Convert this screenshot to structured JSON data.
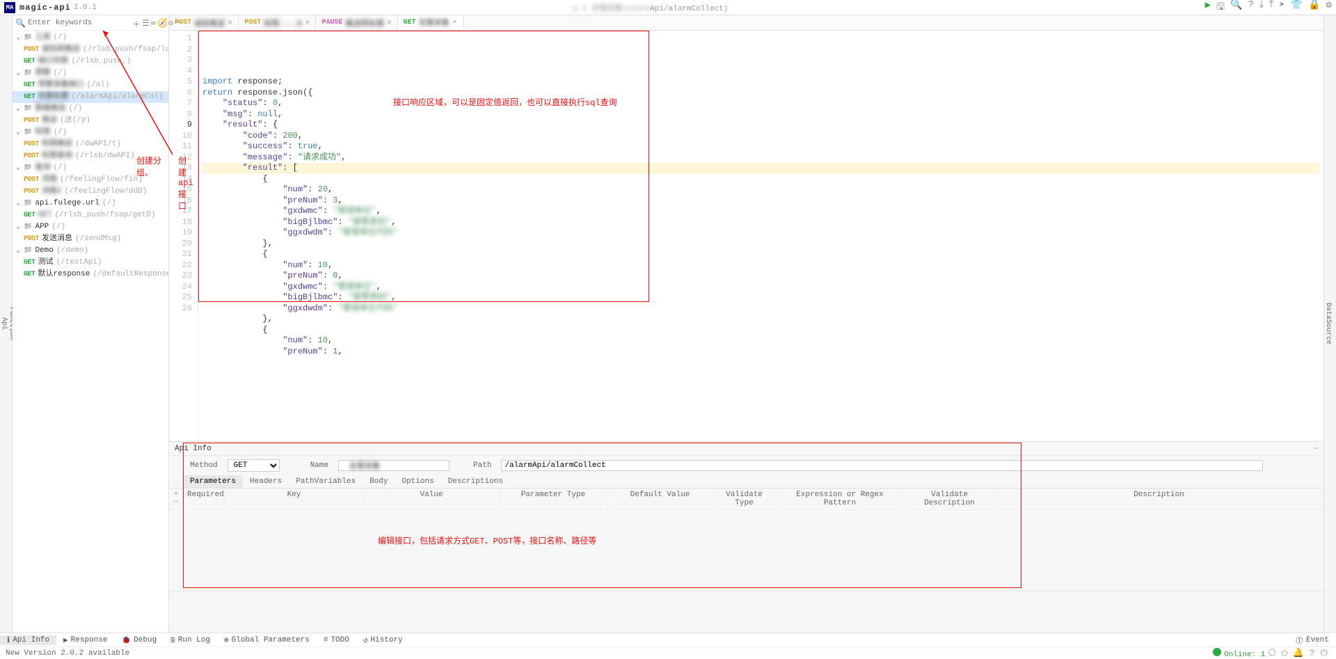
{
  "app": {
    "name": "magic-api",
    "version": "2.0.1",
    "logo": "MA"
  },
  "breadcrumb_suffix": "Api/alarmCollect)",
  "toolbar_icons": [
    "play",
    "save",
    "search",
    "help",
    "cloud-down",
    "cloud-up",
    "send",
    "tshirt",
    "lock",
    "settings"
  ],
  "left_rail": [
    "Api",
    "Function"
  ],
  "right_rail": [
    "DataSource"
  ],
  "tree": {
    "search_placeholder": "Enter keywords",
    "items": [
      {
        "d": 0,
        "type": "folder",
        "name_blur": true,
        "name": "工商",
        "path": "/"
      },
      {
        "d": 1,
        "type": "api",
        "method": "POST",
        "name_blur": true,
        "name": "诚信网推送",
        "path": "/rlsb_push/fsap/login"
      },
      {
        "d": 1,
        "type": "api",
        "method": "GET",
        "name_blur": true,
        "name": "接口列表",
        "path": "/rlsb_push,"
      },
      {
        "d": 0,
        "type": "folder",
        "name_blur": true,
        "name": "预警",
        "path": "/"
      },
      {
        "d": 1,
        "type": "api",
        "method": "GET",
        "name_blur": true,
        "name": "预警采集接口",
        "path": "/al"
      },
      {
        "d": 1,
        "type": "api",
        "method": "GET",
        "name_blur": true,
        "name": "告警处置",
        "path": "/alarmApi/alarmCol",
        "selected": true
      },
      {
        "d": 0,
        "type": "folder",
        "name_blur": true,
        "name": "数据推送",
        "path": "/"
      },
      {
        "d": 1,
        "type": "api",
        "method": "POST",
        "name_blur": true,
        "name": "推送",
        "path": "送(/p"
      },
      {
        "d": 0,
        "type": "folder",
        "name_blur": true,
        "name": "权限",
        "path": "/"
      },
      {
        "d": 1,
        "type": "api",
        "method": "POST",
        "name_blur": true,
        "name": "权限推送",
        "path": "/dwAPI/t"
      },
      {
        "d": 1,
        "type": "api",
        "method": "POST",
        "name_blur": true,
        "name": "权限查询",
        "path": "/rlsb/dwAPI"
      },
      {
        "d": 0,
        "type": "folder",
        "name_blur": true,
        "name": "查询",
        "path": "/"
      },
      {
        "d": 1,
        "type": "api",
        "method": "POST",
        "name_blur": true,
        "name": "流程",
        "path": "/feelingFlow/fin"
      },
      {
        "d": 1,
        "type": "api",
        "method": "POST",
        "name_blur": true,
        "name": "流程2",
        "path": "/feelingFlow/ddD"
      },
      {
        "d": 0,
        "type": "folder",
        "name": "api.fulege.url",
        "path": "/"
      },
      {
        "d": 1,
        "type": "api",
        "method": "GET",
        "name_blur": true,
        "name": "GET",
        "path": "/rlsb_push/fsap/getD"
      },
      {
        "d": 0,
        "type": "folder",
        "name": "APP",
        "path": "/"
      },
      {
        "d": 1,
        "type": "api",
        "method": "POST",
        "name": "发送消息",
        "path": "/sendMsg"
      },
      {
        "d": 0,
        "type": "folder",
        "name": "Demo",
        "path": "/demo"
      },
      {
        "d": 1,
        "type": "api",
        "method": "GET",
        "name": "测试",
        "path": "/testApi"
      },
      {
        "d": 1,
        "type": "api",
        "method": "GET",
        "name": "默认response",
        "path": "/defaultResponse"
      }
    ]
  },
  "tabs": [
    {
      "method": "POST",
      "label_blur": true,
      "label": "诚信推送",
      "close": true
    },
    {
      "method": "POST",
      "label_blur": true,
      "label": "权限....K",
      "close": true
    },
    {
      "method": "PAUSE",
      "label_blur": true,
      "label": "推送预处理",
      "close": true
    },
    {
      "method": "GET",
      "label_blur": true,
      "label": "告警采集",
      "active": true,
      "close": true
    }
  ],
  "gutter_lines": 26,
  "code_tokens": [
    [
      {
        "t": "import",
        "c": "kw"
      },
      {
        "t": " response;",
        "c": "id"
      }
    ],
    [
      {
        "t": "return",
        "c": "kw"
      },
      {
        "t": " response.json({",
        "c": "id"
      }
    ],
    [
      {
        "t": "    ",
        "c": ""
      },
      {
        "t": "\"status\"",
        "c": "prop"
      },
      {
        "t": ": ",
        "c": "id"
      },
      {
        "t": "0",
        "c": "num"
      },
      {
        "t": ",",
        "c": "id"
      }
    ],
    [
      {
        "t": "    ",
        "c": ""
      },
      {
        "t": "\"msg\"",
        "c": "prop"
      },
      {
        "t": ": ",
        "c": "id"
      },
      {
        "t": "null",
        "c": "kw"
      },
      {
        "t": ",",
        "c": "id"
      }
    ],
    [
      {
        "t": "    ",
        "c": ""
      },
      {
        "t": "\"result\"",
        "c": "prop"
      },
      {
        "t": ": {",
        "c": "id"
      }
    ],
    [
      {
        "t": "        ",
        "c": ""
      },
      {
        "t": "\"code\"",
        "c": "prop"
      },
      {
        "t": ": ",
        "c": "id"
      },
      {
        "t": "200",
        "c": "num"
      },
      {
        "t": ",",
        "c": "id"
      }
    ],
    [
      {
        "t": "        ",
        "c": ""
      },
      {
        "t": "\"success\"",
        "c": "prop"
      },
      {
        "t": ": ",
        "c": "id"
      },
      {
        "t": "true",
        "c": "kw"
      },
      {
        "t": ",",
        "c": "id"
      }
    ],
    [
      {
        "t": "        ",
        "c": ""
      },
      {
        "t": "\"message\"",
        "c": "prop"
      },
      {
        "t": ": ",
        "c": "id"
      },
      {
        "t": "\"请求成功\"",
        "c": "str"
      },
      {
        "t": ",",
        "c": "id"
      }
    ],
    [
      {
        "t": "        ",
        "c": ""
      },
      {
        "t": "\"result\"",
        "c": "prop"
      },
      {
        "t": ": [",
        "c": "id"
      }
    ],
    [
      {
        "t": "            {",
        "c": "id"
      }
    ],
    [
      {
        "t": "                ",
        "c": ""
      },
      {
        "t": "\"num\"",
        "c": "prop"
      },
      {
        "t": ": ",
        "c": "id"
      },
      {
        "t": "20",
        "c": "num"
      },
      {
        "t": ",",
        "c": "id"
      }
    ],
    [
      {
        "t": "                ",
        "c": ""
      },
      {
        "t": "\"preNum\"",
        "c": "prop"
      },
      {
        "t": ": ",
        "c": "id"
      },
      {
        "t": "3",
        "c": "num"
      },
      {
        "t": ",",
        "c": "id"
      }
    ],
    [
      {
        "t": "                ",
        "c": ""
      },
      {
        "t": "\"gxdwmc\"",
        "c": "prop"
      },
      {
        "t": ": ",
        "c": "id"
      },
      {
        "t": "\"管辖单位\"",
        "c": "str",
        "blur": true
      },
      {
        "t": ",",
        "c": "id"
      }
    ],
    [
      {
        "t": "                ",
        "c": ""
      },
      {
        "t": "\"bigBjlbmc\"",
        "c": "prop"
      },
      {
        "t": ": ",
        "c": "id"
      },
      {
        "t": "\"报警类别\"",
        "c": "str",
        "blur": true
      },
      {
        "t": ",",
        "c": "id"
      }
    ],
    [
      {
        "t": "                ",
        "c": ""
      },
      {
        "t": "\"ggxdwdm\"",
        "c": "prop"
      },
      {
        "t": ": ",
        "c": "id"
      },
      {
        "t": "\"管辖单位代码\"",
        "c": "str",
        "blur": true
      }
    ],
    [
      {
        "t": "            },",
        "c": "id"
      }
    ],
    [
      {
        "t": "            {",
        "c": "id"
      }
    ],
    [
      {
        "t": "                ",
        "c": ""
      },
      {
        "t": "\"num\"",
        "c": "prop"
      },
      {
        "t": ": ",
        "c": "id"
      },
      {
        "t": "10",
        "c": "num"
      },
      {
        "t": ",",
        "c": "id"
      }
    ],
    [
      {
        "t": "                ",
        "c": ""
      },
      {
        "t": "\"preNum\"",
        "c": "prop"
      },
      {
        "t": ": ",
        "c": "id"
      },
      {
        "t": "0",
        "c": "num"
      },
      {
        "t": ",",
        "c": "id"
      }
    ],
    [
      {
        "t": "                ",
        "c": ""
      },
      {
        "t": "\"gxdwmc\"",
        "c": "prop"
      },
      {
        "t": ": ",
        "c": "id"
      },
      {
        "t": "\"管辖单位\"",
        "c": "str",
        "blur": true
      },
      {
        "t": ",",
        "c": "id"
      }
    ],
    [
      {
        "t": "                ",
        "c": ""
      },
      {
        "t": "\"bigBjlbmc\"",
        "c": "prop"
      },
      {
        "t": ": ",
        "c": "id"
      },
      {
        "t": "\"报警类别\"",
        "c": "str",
        "blur": true
      },
      {
        "t": ",",
        "c": "id"
      }
    ],
    [
      {
        "t": "                ",
        "c": ""
      },
      {
        "t": "\"ggxdwdm\"",
        "c": "prop"
      },
      {
        "t": ": ",
        "c": "id"
      },
      {
        "t": "\"管辖单位代码\"",
        "c": "str",
        "blur": true
      }
    ],
    [
      {
        "t": "            },",
        "c": "id"
      }
    ],
    [
      {
        "t": "            {",
        "c": "id"
      }
    ],
    [
      {
        "t": "                ",
        "c": ""
      },
      {
        "t": "\"num\"",
        "c": "prop"
      },
      {
        "t": ": ",
        "c": "id"
      },
      {
        "t": "10",
        "c": "num"
      },
      {
        "t": ",",
        "c": "id"
      }
    ],
    [
      {
        "t": "                ",
        "c": ""
      },
      {
        "t": "\"preNum\"",
        "c": "prop"
      },
      {
        "t": ": ",
        "c": "id"
      },
      {
        "t": "1",
        "c": "num"
      },
      {
        "t": ",",
        "c": "id"
      }
    ]
  ],
  "code_highlight_line": 9,
  "code_annotation": "接口响应区域，可以是固定值返回，也可以直接执行sql查询",
  "tree_annotation_group": "创建分组、",
  "tree_annotation_api": "创建api接口",
  "apiinfo": {
    "title": "Api Info",
    "method_label": "Method",
    "method_value": "GET",
    "name_label": "Name",
    "name_value": "告警采集",
    "path_label": "Path",
    "path_value": "/alarmApi/alarmCollect",
    "tabs": [
      "Parameters",
      "Headers",
      "PathVariables",
      "Body",
      "Options",
      "Descriptions"
    ],
    "active_tab": 0,
    "grid_headers": [
      "Required",
      "Key",
      "Value",
      "Parameter Type",
      "Default Value",
      "Validate Type",
      "Expression or Regex Pattern",
      "Validate Description",
      "Description"
    ],
    "annotation": "编辑接口，包括请求方式GET、POST等，接口名称、路径等"
  },
  "footer_tabs": [
    {
      "icon": "ℹ",
      "label": "Api Info",
      "active": true
    },
    {
      "icon": "▶",
      "label": "Response"
    },
    {
      "icon": "🐞",
      "label": "Debug"
    },
    {
      "icon": "≣",
      "label": "Run Log"
    },
    {
      "icon": "⊕",
      "label": "Global Parameters"
    },
    {
      "icon": "≡",
      "label": "TODO"
    },
    {
      "icon": "↺",
      "label": "History"
    }
  ],
  "footer_right": [
    {
      "icon": "⓵",
      "label": "Event"
    }
  ],
  "statusbar": {
    "left": "New Version 2.0.2 available",
    "online_label": "Online: ",
    "online_count": "1"
  }
}
